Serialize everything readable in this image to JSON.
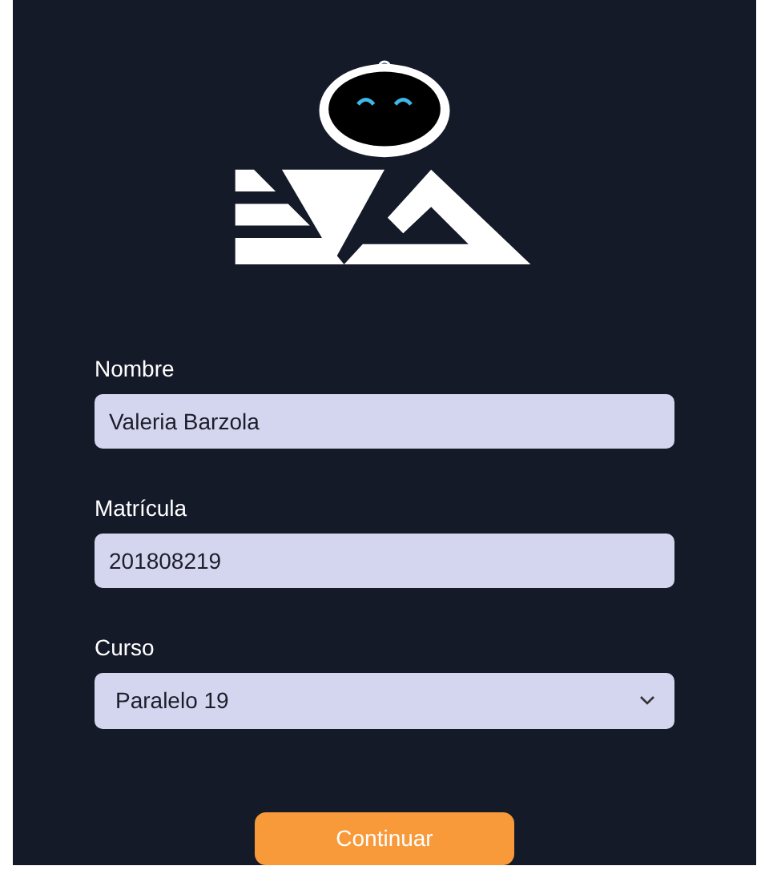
{
  "fields": [
    {
      "kind": "text",
      "label": "Nombre",
      "value": "Valeria Barzola"
    },
    {
      "kind": "text",
      "label": "Matrícula",
      "value": "201808219"
    },
    {
      "kind": "select",
      "label": "Curso",
      "value": "Paralelo 19"
    }
  ],
  "button": "Continuar"
}
